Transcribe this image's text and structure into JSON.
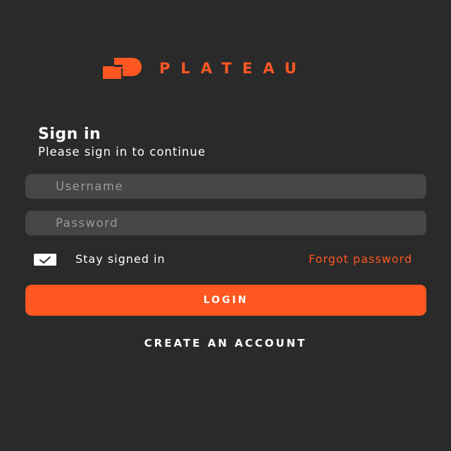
{
  "brand": {
    "name": "PLATEAU",
    "logo_icon": "plateau-logo-icon",
    "accent_color": "#ff5722"
  },
  "colors": {
    "background": "#2a2a2a",
    "field_background": "#464646",
    "text": "#ffffff"
  },
  "form": {
    "title": "Sign in",
    "subtitle": "Please sign in to continue",
    "username": {
      "value": "",
      "placeholder": "Username"
    },
    "password": {
      "value": "",
      "placeholder": "Password"
    },
    "stay_signed_in": {
      "label": "Stay signed in",
      "checked": true,
      "icon": "check-icon"
    },
    "forgot_password_label": "Forgot password",
    "login_label": "LOGIN",
    "create_account_label": "CREATE AN ACCOUNT"
  }
}
